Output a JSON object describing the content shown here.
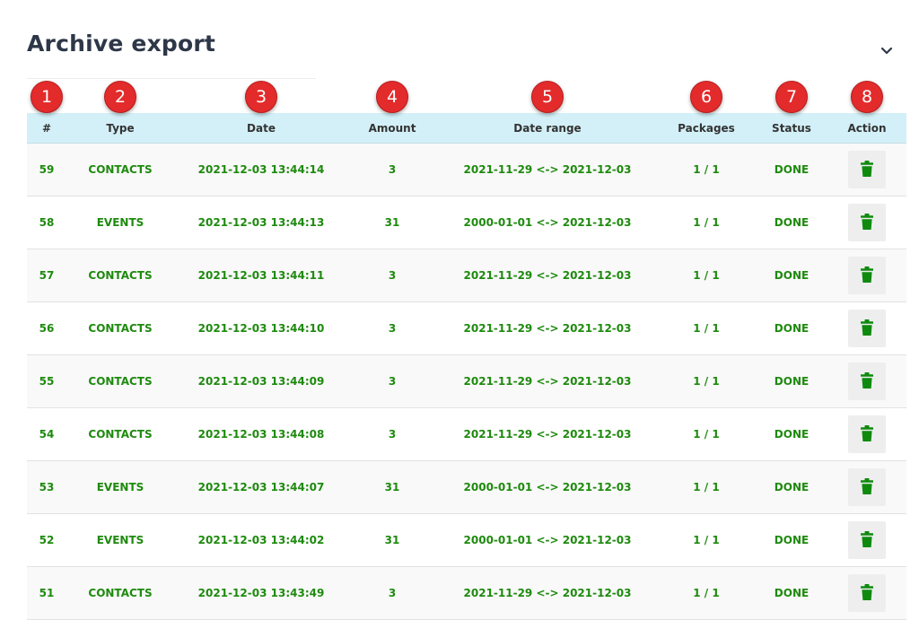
{
  "header": {
    "title": "Archive export"
  },
  "badges": [
    "1",
    "2",
    "3",
    "4",
    "5",
    "6",
    "7",
    "8"
  ],
  "table": {
    "columns": [
      "#",
      "Type",
      "Date",
      "Amount",
      "Date range",
      "Packages",
      "Status",
      "Action"
    ],
    "rows": [
      {
        "id": "59",
        "type": "CONTACTS",
        "date": "2021-12-03 13:44:14",
        "amount": "3",
        "range": "2021-11-29 <-> 2021-12-03",
        "packages": "1 / 1",
        "status": "DONE"
      },
      {
        "id": "58",
        "type": "EVENTS",
        "date": "2021-12-03 13:44:13",
        "amount": "31",
        "range": "2000-01-01 <-> 2021-12-03",
        "packages": "1 / 1",
        "status": "DONE"
      },
      {
        "id": "57",
        "type": "CONTACTS",
        "date": "2021-12-03 13:44:11",
        "amount": "3",
        "range": "2021-11-29 <-> 2021-12-03",
        "packages": "1 / 1",
        "status": "DONE"
      },
      {
        "id": "56",
        "type": "CONTACTS",
        "date": "2021-12-03 13:44:10",
        "amount": "3",
        "range": "2021-11-29 <-> 2021-12-03",
        "packages": "1 / 1",
        "status": "DONE"
      },
      {
        "id": "55",
        "type": "CONTACTS",
        "date": "2021-12-03 13:44:09",
        "amount": "3",
        "range": "2021-11-29 <-> 2021-12-03",
        "packages": "1 / 1",
        "status": "DONE"
      },
      {
        "id": "54",
        "type": "CONTACTS",
        "date": "2021-12-03 13:44:08",
        "amount": "3",
        "range": "2021-11-29 <-> 2021-12-03",
        "packages": "1 / 1",
        "status": "DONE"
      },
      {
        "id": "53",
        "type": "EVENTS",
        "date": "2021-12-03 13:44:07",
        "amount": "31",
        "range": "2000-01-01 <-> 2021-12-03",
        "packages": "1 / 1",
        "status": "DONE"
      },
      {
        "id": "52",
        "type": "EVENTS",
        "date": "2021-12-03 13:44:02",
        "amount": "31",
        "range": "2000-01-01 <-> 2021-12-03",
        "packages": "1 / 1",
        "status": "DONE"
      },
      {
        "id": "51",
        "type": "CONTACTS",
        "date": "2021-12-03 13:43:49",
        "amount": "3",
        "range": "2021-11-29 <-> 2021-12-03",
        "packages": "1 / 1",
        "status": "DONE"
      }
    ]
  },
  "icons": {
    "collapse": "chevron-down-icon",
    "delete": "trash-icon"
  },
  "colors": {
    "accent_green": "#1e8a0e",
    "header_bg": "#d3f0f8",
    "badge_red": "#e32b2b",
    "trash_green": "#0f8a0f"
  }
}
